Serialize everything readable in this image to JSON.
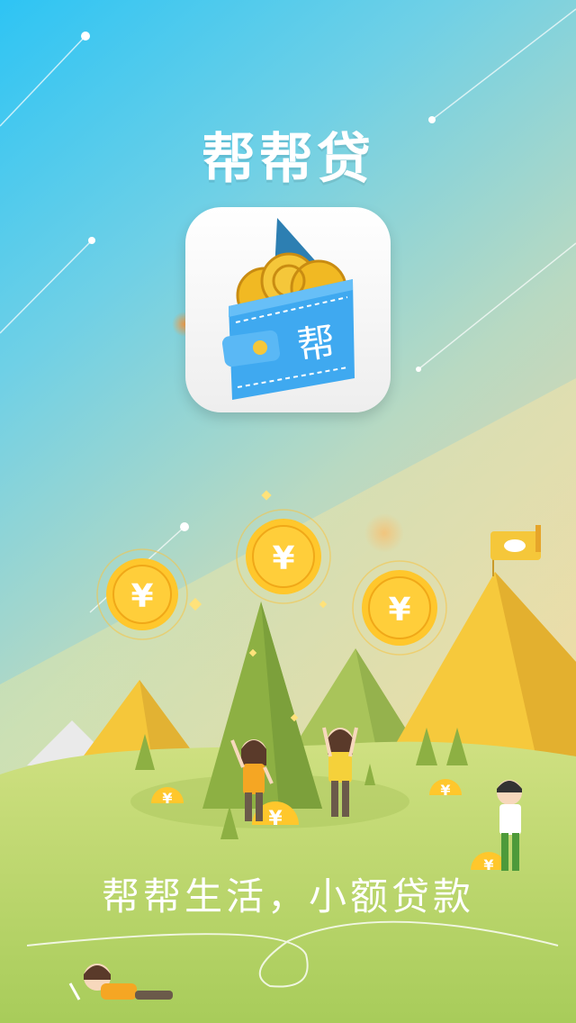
{
  "app": {
    "title": "帮帮贷",
    "icon_char": "帮"
  },
  "slogan": "帮帮生活，小额贷款",
  "coins": {
    "symbol": "¥"
  },
  "colors": {
    "sky_top": "#2ec4f4",
    "sky_bottom": "#f4c29a",
    "grass": "#bcd668",
    "mountain": "#f5c73a",
    "coin": "#ffc72c",
    "wallet": "#3fa9f0"
  },
  "icons": {
    "app_icon": "wallet-with-coins-icon",
    "flag": "flag-icon"
  }
}
